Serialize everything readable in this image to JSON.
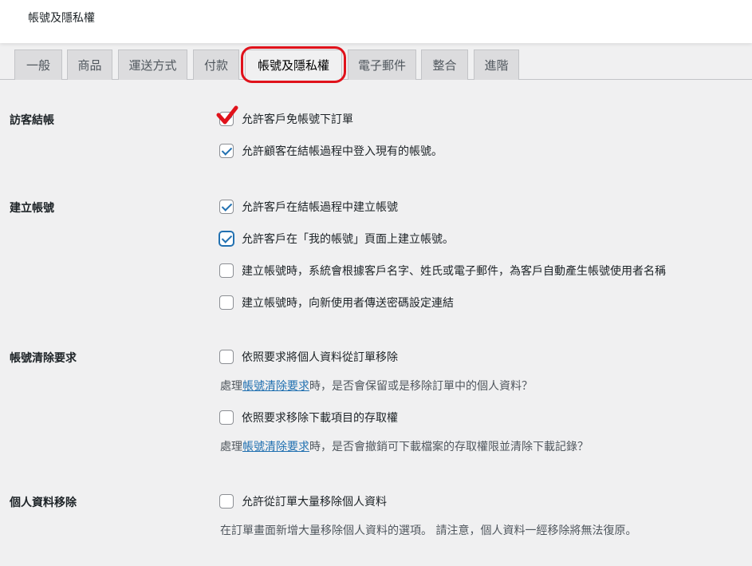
{
  "header": {
    "title": "帳號及隱私權"
  },
  "tabs": [
    {
      "label": "一般"
    },
    {
      "label": "商品"
    },
    {
      "label": "運送方式"
    },
    {
      "label": "付款"
    },
    {
      "label": "帳號及隱私權"
    },
    {
      "label": "電子郵件"
    },
    {
      "label": "整合"
    },
    {
      "label": "進階"
    }
  ],
  "sections": {
    "guest_checkout": {
      "label": "訪客結帳",
      "options": [
        {
          "label": "允許客戶免帳號下訂單",
          "checked": true
        },
        {
          "label": "允許顧客在結帳過程中登入現有的帳號。",
          "checked": true
        }
      ]
    },
    "account_creation": {
      "label": "建立帳號",
      "options": [
        {
          "label": "允許客戶在結帳過程中建立帳號",
          "checked": true
        },
        {
          "label": "允許客戶在「我的帳號」頁面上建立帳號。",
          "checked": true
        },
        {
          "label": "建立帳號時，系統會根據客戶名字、姓氏或電子郵件，為客戶自動產生帳號使用者名稱",
          "checked": false
        },
        {
          "label": "建立帳號時，向新使用者傳送密碼設定連結",
          "checked": false
        }
      ]
    },
    "erasure": {
      "label": "帳號清除要求",
      "option1": {
        "label": "依照要求將個人資料從訂單移除",
        "checked": false
      },
      "desc1": {
        "prefix": "處理",
        "link": "帳號清除要求",
        "suffix": "時，是否會保留或是移除訂單中的個人資料？"
      },
      "option2": {
        "label": "依照要求移除下載項目的存取權",
        "checked": false
      },
      "desc2": {
        "prefix": "處理",
        "link": "帳號清除要求",
        "suffix": "時，是否會撤銷可下載檔案的存取權限並清除下載記錄？"
      }
    },
    "personal_data_removal": {
      "label": "個人資料移除",
      "option": {
        "label": "允許從訂單大量移除個人資料",
        "checked": false
      },
      "desc": "在訂單畫面新增大量移除個人資料的選項。 請注意，個人資料一經移除將無法復原。"
    }
  },
  "colors": {
    "accent": "#2271b1",
    "highlight": "#e0121b",
    "background": "#f0f0f1"
  },
  "icons": {
    "annotation": "red-checkmark-icon",
    "checkbox_check": "checkmark-icon"
  }
}
